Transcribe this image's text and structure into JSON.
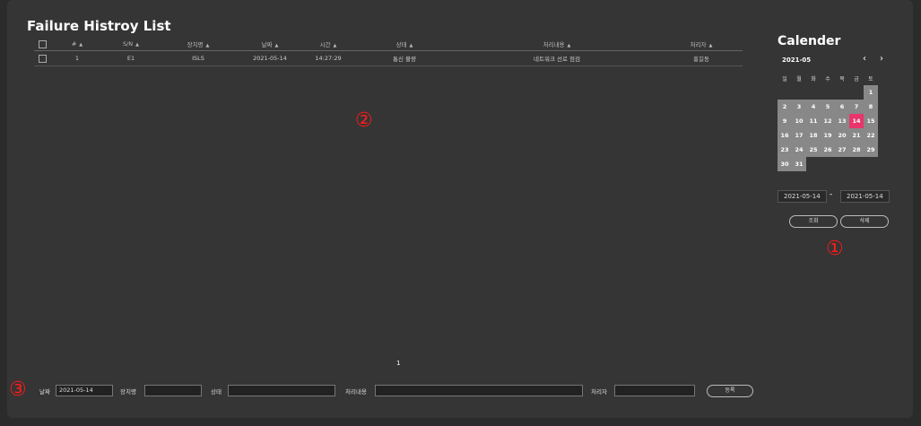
{
  "page": {
    "title": "Failure Histroy List"
  },
  "table": {
    "headers": [
      "#",
      "S/N",
      "장치명",
      "날짜",
      "시간",
      "상태",
      "처리내용",
      "처리자"
    ],
    "rows": [
      [
        "1",
        "E1",
        "ISLS",
        "2021-05-14",
        "14:27:29",
        "통신 불량",
        "네트워크 선로 점검",
        "홍길동"
      ]
    ]
  },
  "annotations": {
    "one": "①",
    "two": "②",
    "three": "③"
  },
  "pager": {
    "current": "1"
  },
  "calendar": {
    "title": "Calender",
    "month": "2021-05",
    "prev": "‹",
    "next": "›",
    "weekdays": [
      "일",
      "월",
      "화",
      "수",
      "목",
      "금",
      "토"
    ],
    "days": [
      "1",
      "2",
      "3",
      "4",
      "5",
      "6",
      "7",
      "8",
      "9",
      "10",
      "11",
      "12",
      "13",
      "14",
      "15",
      "16",
      "17",
      "18",
      "19",
      "20",
      "21",
      "22",
      "23",
      "24",
      "25",
      "26",
      "27",
      "28",
      "29",
      "30",
      "31"
    ],
    "selected": "14",
    "range_start": "2021-05-14",
    "range_sep": "-",
    "range_end": "2021-05-14",
    "search_label": "조회",
    "delete_label": "삭제"
  },
  "form": {
    "date_label": "날짜",
    "date_value": "2021-05-14",
    "device_label": "장치명",
    "device_value": "",
    "status_label": "상태",
    "status_value": "",
    "content_label": "처리내용",
    "content_value": "",
    "handler_label": "처리자",
    "handler_value": "",
    "register_label": "등록"
  },
  "colors": {
    "selected_day": "#e8356c",
    "annotation": "#ff1a1a"
  }
}
